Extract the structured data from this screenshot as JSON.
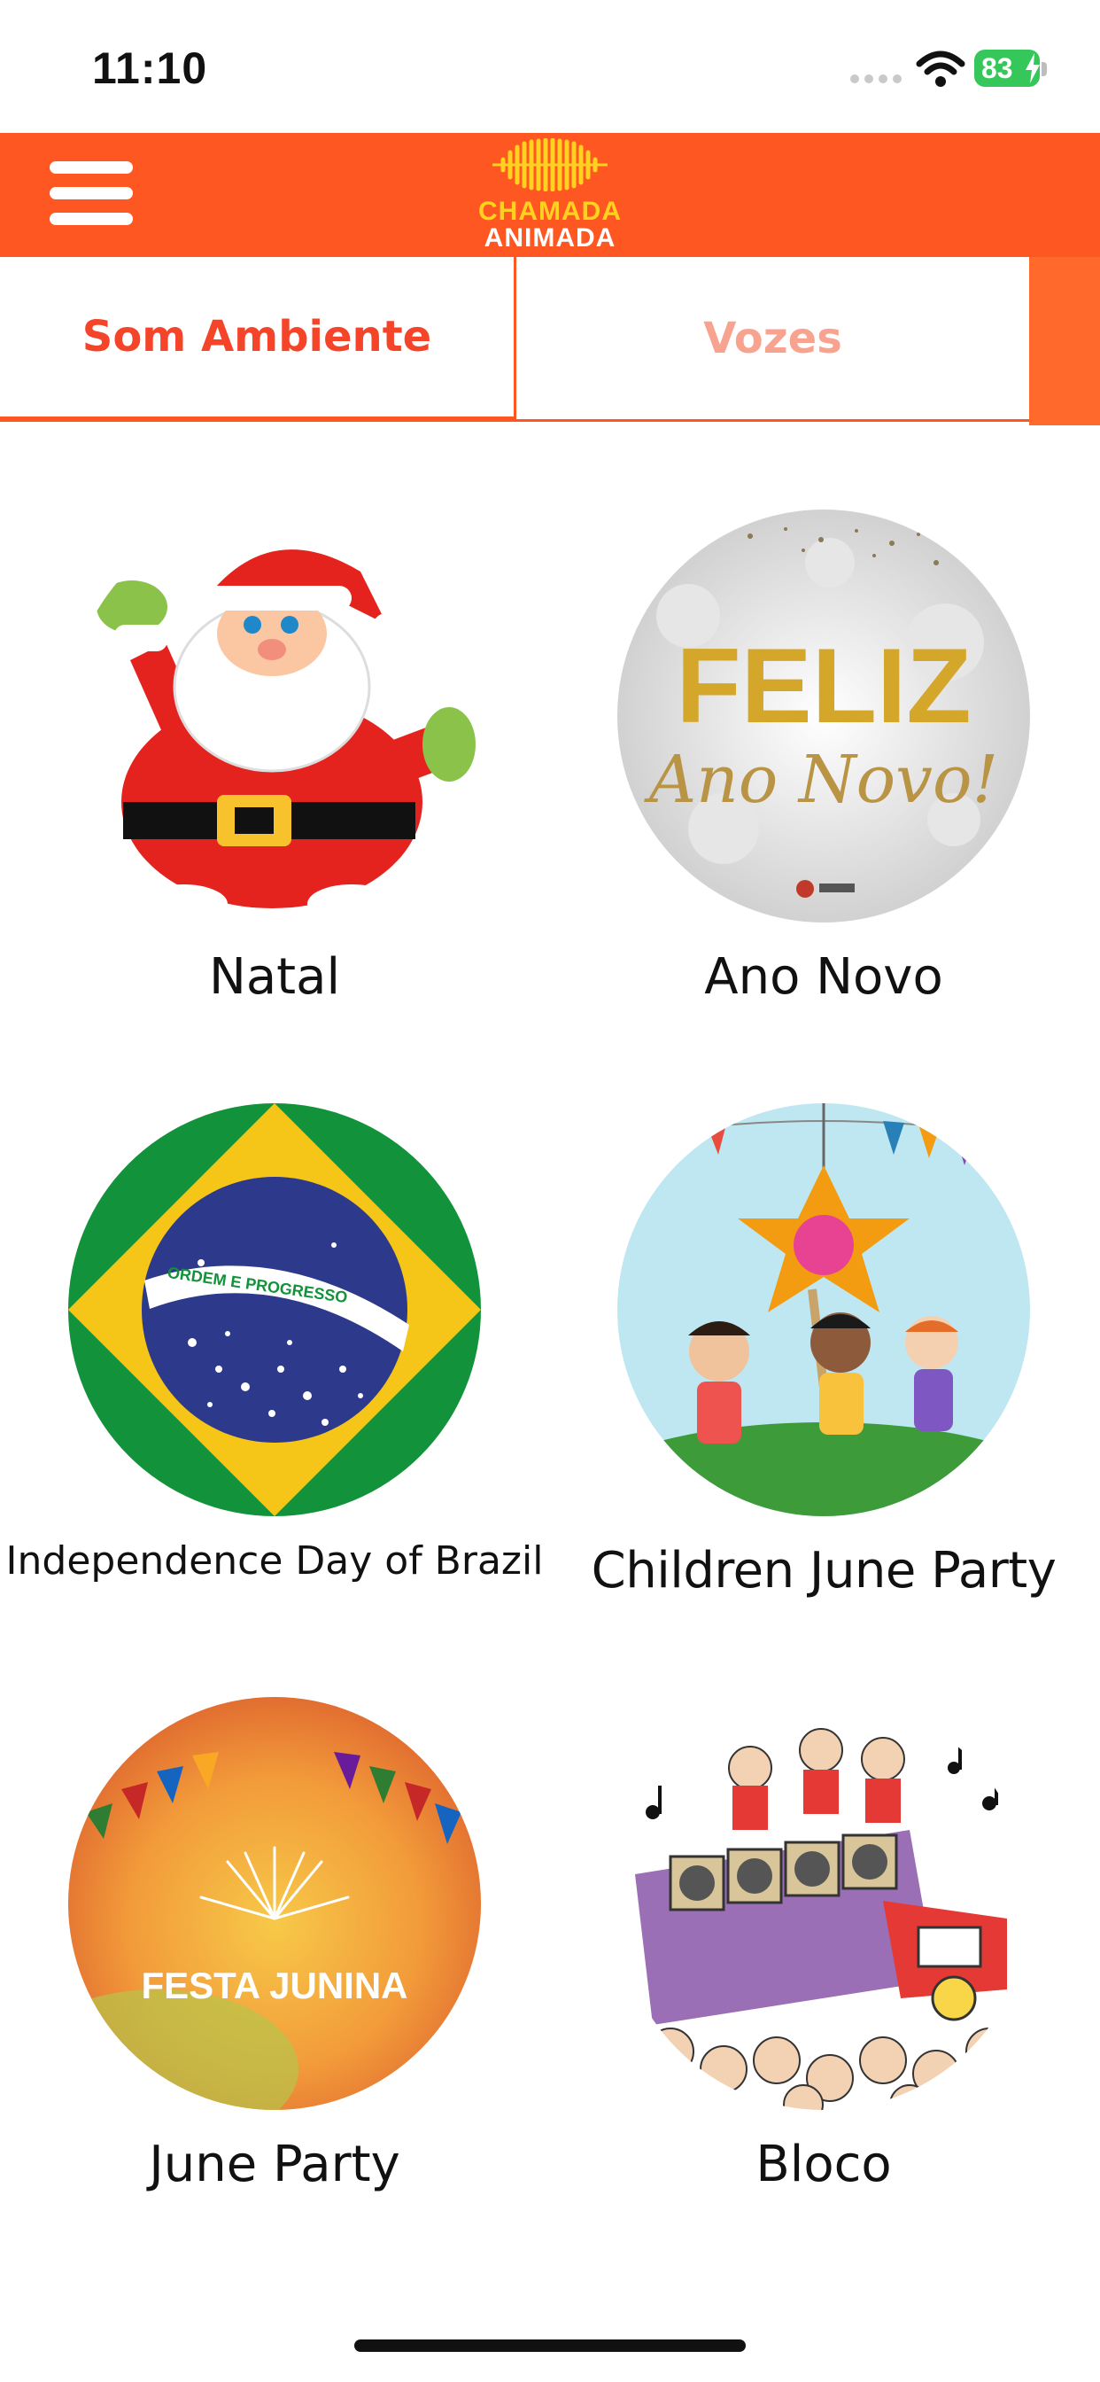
{
  "status_bar": {
    "time": "11:10",
    "battery": "83",
    "icons": [
      "signal-dots-icon",
      "wifi-icon",
      "battery-icon"
    ]
  },
  "app_bar": {
    "menu_icon": "hamburger-menu-icon",
    "logo_line1": "CHAMADA",
    "logo_line2": "ANIMADA",
    "colors": {
      "bar": "#ff5722",
      "logo_yellow": "#ffd21f"
    }
  },
  "tabs": [
    {
      "label": "Som Ambiente",
      "selected": true,
      "color": "#f4452a"
    },
    {
      "label": "Vozes",
      "selected": false,
      "color": "#f8a38f"
    }
  ],
  "categories": [
    {
      "label": "Natal",
      "image": "santa-claus-icon"
    },
    {
      "label": "Ano Novo",
      "image": "feliz-ano-novo-icon",
      "image_text_1": "FELIZ",
      "image_text_2": "Ano Novo!"
    },
    {
      "label": "Independence Day of Brazil",
      "image": "brazil-flag-icon",
      "image_text": "ORDEM E PROGRESSO"
    },
    {
      "label": "Children June Party",
      "image": "pinata-party-icon"
    },
    {
      "label": "June Party",
      "image": "festa-junina-icon",
      "image_text": "FESTA JUNINA"
    },
    {
      "label": "Bloco",
      "image": "carnival-bloco-icon"
    }
  ]
}
